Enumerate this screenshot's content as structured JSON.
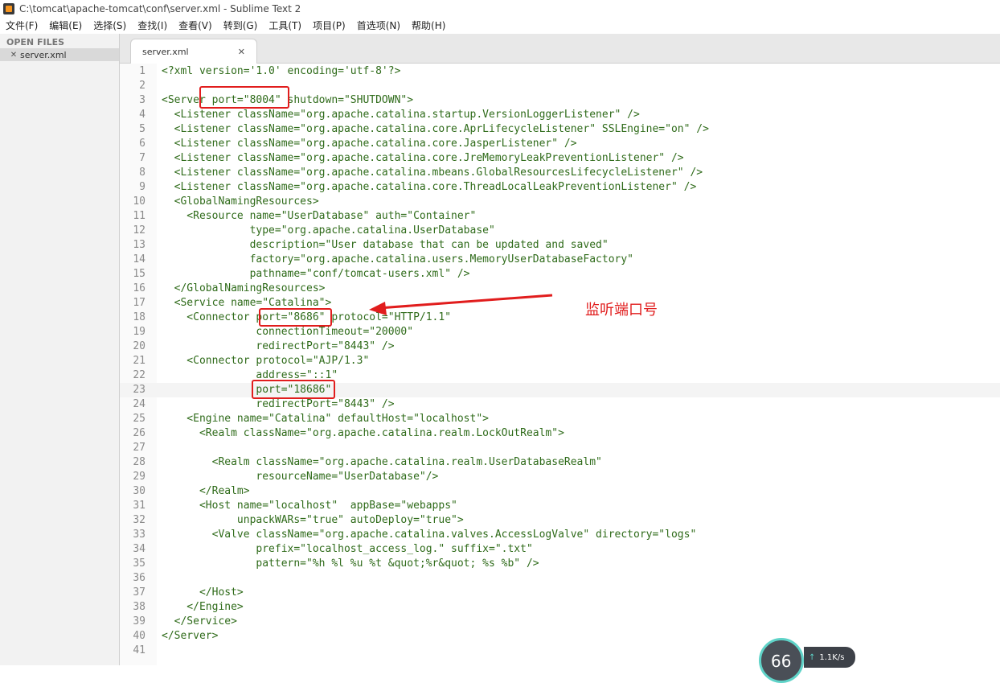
{
  "window": {
    "title": "C:\\tomcat\\apache-tomcat\\conf\\server.xml - Sublime Text 2"
  },
  "menu": [
    {
      "label": "文件(F)"
    },
    {
      "label": "编辑(E)"
    },
    {
      "label": "选择(S)"
    },
    {
      "label": "查找(I)"
    },
    {
      "label": "查看(V)"
    },
    {
      "label": "转到(G)"
    },
    {
      "label": "工具(T)"
    },
    {
      "label": "项目(P)"
    },
    {
      "label": "首选项(N)"
    },
    {
      "label": "帮助(H)"
    }
  ],
  "sidebar": {
    "heading": "OPEN FILES",
    "files": [
      {
        "name": "server.xml",
        "close": "✕"
      }
    ]
  },
  "tabs": [
    {
      "label": "server.xml",
      "close": "✕"
    }
  ],
  "editor": {
    "active_line": 23,
    "lines": [
      {
        "n": "1",
        "text": "<?xml version='1.0' encoding='utf-8'?>"
      },
      {
        "n": "2",
        "text": ""
      },
      {
        "n": "3",
        "text": "<Server port=\"8004\" shutdown=\"SHUTDOWN\">"
      },
      {
        "n": "4",
        "text": "  <Listener className=\"org.apache.catalina.startup.VersionLoggerListener\" />"
      },
      {
        "n": "5",
        "text": "  <Listener className=\"org.apache.catalina.core.AprLifecycleListener\" SSLEngine=\"on\" />"
      },
      {
        "n": "6",
        "text": "  <Listener className=\"org.apache.catalina.core.JasperListener\" />"
      },
      {
        "n": "7",
        "text": "  <Listener className=\"org.apache.catalina.core.JreMemoryLeakPreventionListener\" />"
      },
      {
        "n": "8",
        "text": "  <Listener className=\"org.apache.catalina.mbeans.GlobalResourcesLifecycleListener\" />"
      },
      {
        "n": "9",
        "text": "  <Listener className=\"org.apache.catalina.core.ThreadLocalLeakPreventionListener\" />"
      },
      {
        "n": "10",
        "text": "  <GlobalNamingResources>"
      },
      {
        "n": "11",
        "text": "    <Resource name=\"UserDatabase\" auth=\"Container\""
      },
      {
        "n": "12",
        "text": "              type=\"org.apache.catalina.UserDatabase\""
      },
      {
        "n": "13",
        "text": "              description=\"User database that can be updated and saved\""
      },
      {
        "n": "14",
        "text": "              factory=\"org.apache.catalina.users.MemoryUserDatabaseFactory\""
      },
      {
        "n": "15",
        "text": "              pathname=\"conf/tomcat-users.xml\" />"
      },
      {
        "n": "16",
        "text": "  </GlobalNamingResources>"
      },
      {
        "n": "17",
        "text": "  <Service name=\"Catalina\">"
      },
      {
        "n": "18",
        "text": "    <Connector port=\"8686\" protocol=\"HTTP/1.1\""
      },
      {
        "n": "19",
        "text": "               connectionTimeout=\"20000\""
      },
      {
        "n": "20",
        "text": "               redirectPort=\"8443\" />"
      },
      {
        "n": "21",
        "text": "    <Connector protocol=\"AJP/1.3\""
      },
      {
        "n": "22",
        "text": "               address=\"::1\""
      },
      {
        "n": "23",
        "text": "               port=\"18686\""
      },
      {
        "n": "24",
        "text": "               redirectPort=\"8443\" />"
      },
      {
        "n": "25",
        "text": "    <Engine name=\"Catalina\" defaultHost=\"localhost\">"
      },
      {
        "n": "26",
        "text": "      <Realm className=\"org.apache.catalina.realm.LockOutRealm\">"
      },
      {
        "n": "27",
        "text": ""
      },
      {
        "n": "28",
        "text": "        <Realm className=\"org.apache.catalina.realm.UserDatabaseRealm\""
      },
      {
        "n": "29",
        "text": "               resourceName=\"UserDatabase\"/>"
      },
      {
        "n": "30",
        "text": "      </Realm>"
      },
      {
        "n": "31",
        "text": "      <Host name=\"localhost\"  appBase=\"webapps\""
      },
      {
        "n": "32",
        "text": "            unpackWARs=\"true\" autoDeploy=\"true\">"
      },
      {
        "n": "33",
        "text": "        <Valve className=\"org.apache.catalina.valves.AccessLogValve\" directory=\"logs\""
      },
      {
        "n": "34",
        "text": "               prefix=\"localhost_access_log.\" suffix=\".txt\""
      },
      {
        "n": "35",
        "text": "               pattern=\"%h %l %u %t &quot;%r&quot; %s %b\" />"
      },
      {
        "n": "36",
        "text": ""
      },
      {
        "n": "37",
        "text": "      </Host>"
      },
      {
        "n": "38",
        "text": "    </Engine>"
      },
      {
        "n": "39",
        "text": "  </Service>"
      },
      {
        "n": "40",
        "text": "</Server>"
      },
      {
        "n": "41",
        "text": ""
      }
    ]
  },
  "annotation": {
    "label": "监听端口号",
    "color": "#e11d1d"
  },
  "net_widget": {
    "dial_value": "66",
    "speed": "1.1K/s",
    "arrow": "↑"
  }
}
